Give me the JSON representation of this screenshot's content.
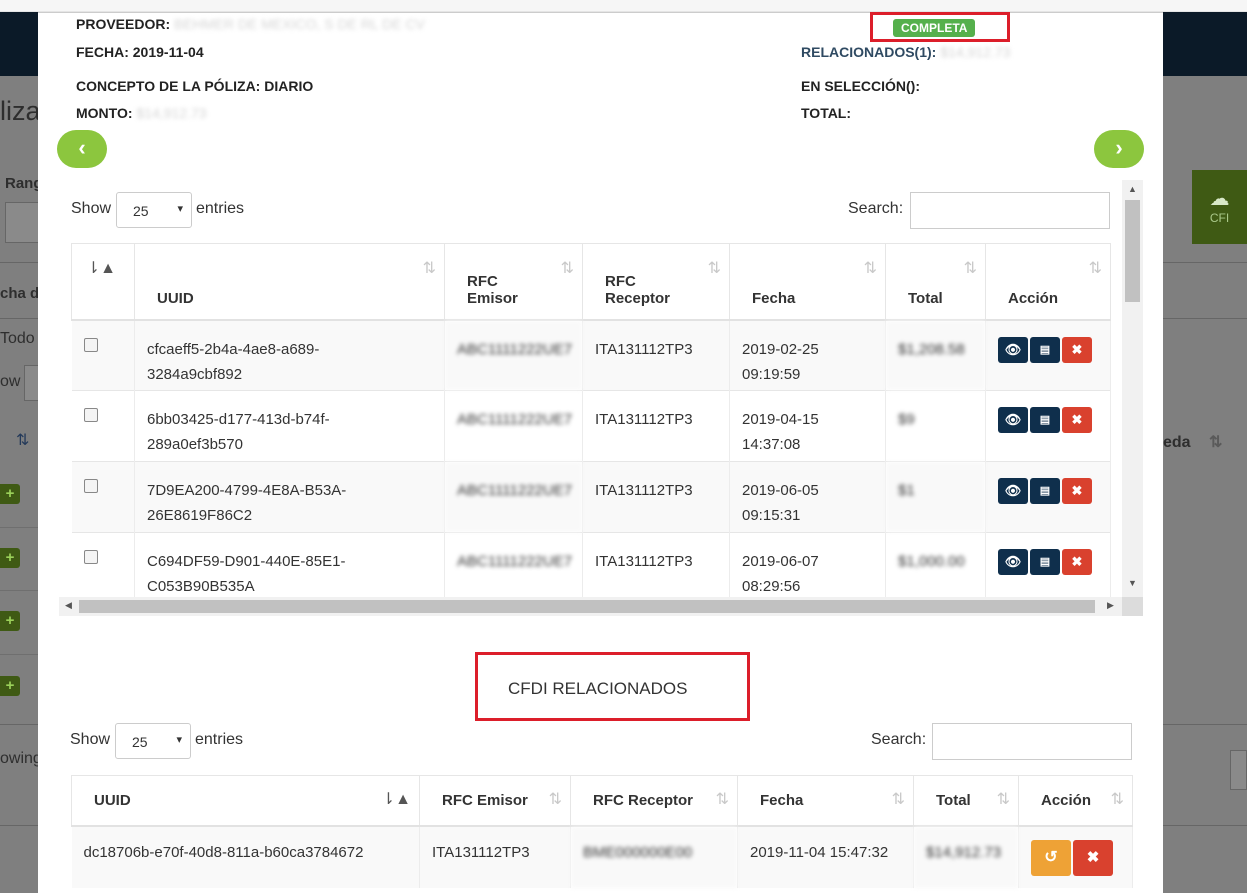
{
  "background": {
    "title": "liza",
    "rango_label": "Rang",
    "fecha_label": "cha d",
    "todo_label": "Todo",
    "show_label": "ow",
    "showing_label": "owing",
    "right_button_label": "CFI",
    "right_column_label": "eda"
  },
  "poliza": {
    "proveedor_label": "PROVEEDOR:",
    "proveedor_value": "BEHMER DE MEXICO, S DE RL DE CV",
    "fecha": "FECHA: 2019-11-04",
    "concepto": "CONCEPTO DE LA PÓLIZA: DIARIO",
    "monto_label": "MONTO:",
    "monto_value": "$14,912.73",
    "status": "COMPLETA",
    "relacionados_label": "RELACIONADOS(1):",
    "relacionados_value": "$14,912.73",
    "en_seleccion_label": "EN SELECCIÓN():",
    "total_label": "TOTAL:"
  },
  "nav": {
    "prev_icon": "chevron-left-icon",
    "next_icon": "chevron-right-icon"
  },
  "table1": {
    "show_label": "Show",
    "entries_value": "25",
    "entries_label": "entries",
    "search_label": "Search:",
    "headers": [
      "",
      "UUID",
      "RFC\nEmisor",
      "RFC\nReceptor",
      "Fecha",
      "Total",
      "Acción"
    ],
    "rows": [
      {
        "uuid": "cfcaeff5-2b4a-4ae8-a689-\n3284a9cbf892",
        "rfc_emisor": "ABC1111222UE7",
        "rfc_receptor": "ITA131112TP3",
        "fecha": "2019-02-25\n09:19:59",
        "total": "$1,208.58"
      },
      {
        "uuid": "6bb03425-d177-413d-b74f-\n289a0ef3b570",
        "rfc_emisor": "ABC1111222UE7",
        "rfc_receptor": "ITA131112TP3",
        "fecha": "2019-04-15\n14:37:08",
        "total": "$9"
      },
      {
        "uuid": "7D9EA200-4799-4E8A-B53A-\n26E8619F86C2",
        "rfc_emisor": "ABC1111222UE7",
        "rfc_receptor": "ITA131112TP3",
        "fecha": "2019-06-05\n09:15:31",
        "total": "$1"
      },
      {
        "uuid": "C694DF59-D901-440E-85E1-\nC053B90B535A",
        "rfc_emisor": "ABC1111222UE7",
        "rfc_receptor": "ITA131112TP3",
        "fecha": "2019-06-07\n08:29:56",
        "total": "$1,000.00"
      }
    ]
  },
  "section2_title": "CFDI RELACIONADOS",
  "table2": {
    "show_label": "Show",
    "entries_value": "25",
    "entries_label": "entries",
    "search_label": "Search:",
    "headers": [
      "UUID",
      "RFC Emisor",
      "RFC Receptor",
      "Fecha",
      "Total",
      "Acción"
    ],
    "rows": [
      {
        "uuid": "dc18706b-e70f-40d8-811a-b60ca3784672",
        "rfc_emisor": "ITA131112TP3",
        "rfc_receptor": "BME000000E00",
        "fecha": "2019-11-04 15:47:32",
        "total": "$14,912.73"
      }
    ]
  },
  "colors": {
    "accent_green": "#8cc63e",
    "badge_green": "#55b04c",
    "highlight_red": "#dc1e2a",
    "action_navy": "#0f2f4c",
    "action_red": "#d9412e",
    "action_orange": "#eea236"
  }
}
